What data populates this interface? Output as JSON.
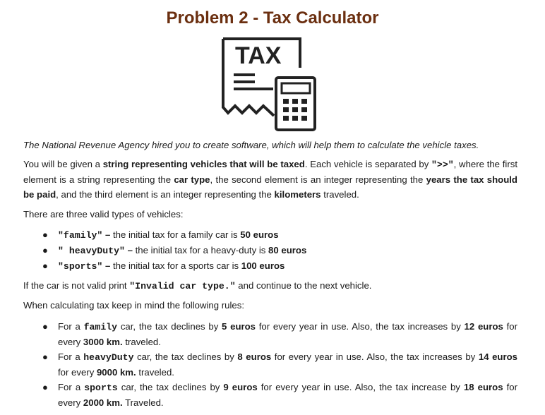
{
  "title": "Problem 2 - Tax Calculator",
  "logo": {
    "text": "TAX",
    "icon": "tax-document-calculator-icon"
  },
  "intro": "The National Revenue Agency hired you to create software, which will help them to calculate the vehicle taxes.",
  "p1": {
    "a": "You will be given a ",
    "b": "string representing vehicles that will be taxed",
    "c": ". Each vehicle is separated by ",
    "d": "\">>\"",
    "e": ", where the first element is a string representing the ",
    "f": "car type",
    "g": ", the second element is an integer representing the ",
    "h": "years the tax should be paid",
    "i": ", and the third element is an integer representing the ",
    "j": "kilometers",
    "k": " traveled."
  },
  "p2": "There are three valid types of vehicles:",
  "types": [
    {
      "code": "\"family\"",
      "dash": " – ",
      "text": "the initial tax for a family car is ",
      "amount": "50 euros"
    },
    {
      "code": "\" heavyDuty\"",
      "dash": " – ",
      "text": "the initial tax for a heavy-duty is ",
      "amount": "80 euros"
    },
    {
      "code": "\"sports\"",
      "dash": " – ",
      "text": "the initial tax for a sports car is ",
      "amount": "100 euros"
    }
  ],
  "p3": {
    "a": "If the car is not valid print ",
    "b": "\"Invalid car type.\"",
    "c": " and continue to the next vehicle."
  },
  "p4": "When calculating tax keep in mind the following rules:",
  "rules": [
    {
      "a": "For a ",
      "car": "family",
      "b": " car, the tax declines by ",
      "dec": "5 euros",
      "c": " for every year in use. Also, the tax increases by ",
      "inc": "12 euros",
      "d": " for every ",
      "km": "3000 km.",
      "e": " traveled."
    },
    {
      "a": "For a ",
      "car": "heavyDuty",
      "b": " car, the tax declines by ",
      "dec": "8 euros",
      "c": " for every year in use. Also, the tax increases by ",
      "inc": "14 euros",
      "d": " for every ",
      "km": "9000 km.",
      "e": " traveled."
    },
    {
      "a": "For a ",
      "car": "sports",
      "b": " car, the tax declines by ",
      "dec": "9 euros",
      "c": " for every year in use. Also, the tax increase by ",
      "inc": "18 euros",
      "d": " for every ",
      "km": "2000 km.",
      "e": " Traveled."
    }
  ]
}
